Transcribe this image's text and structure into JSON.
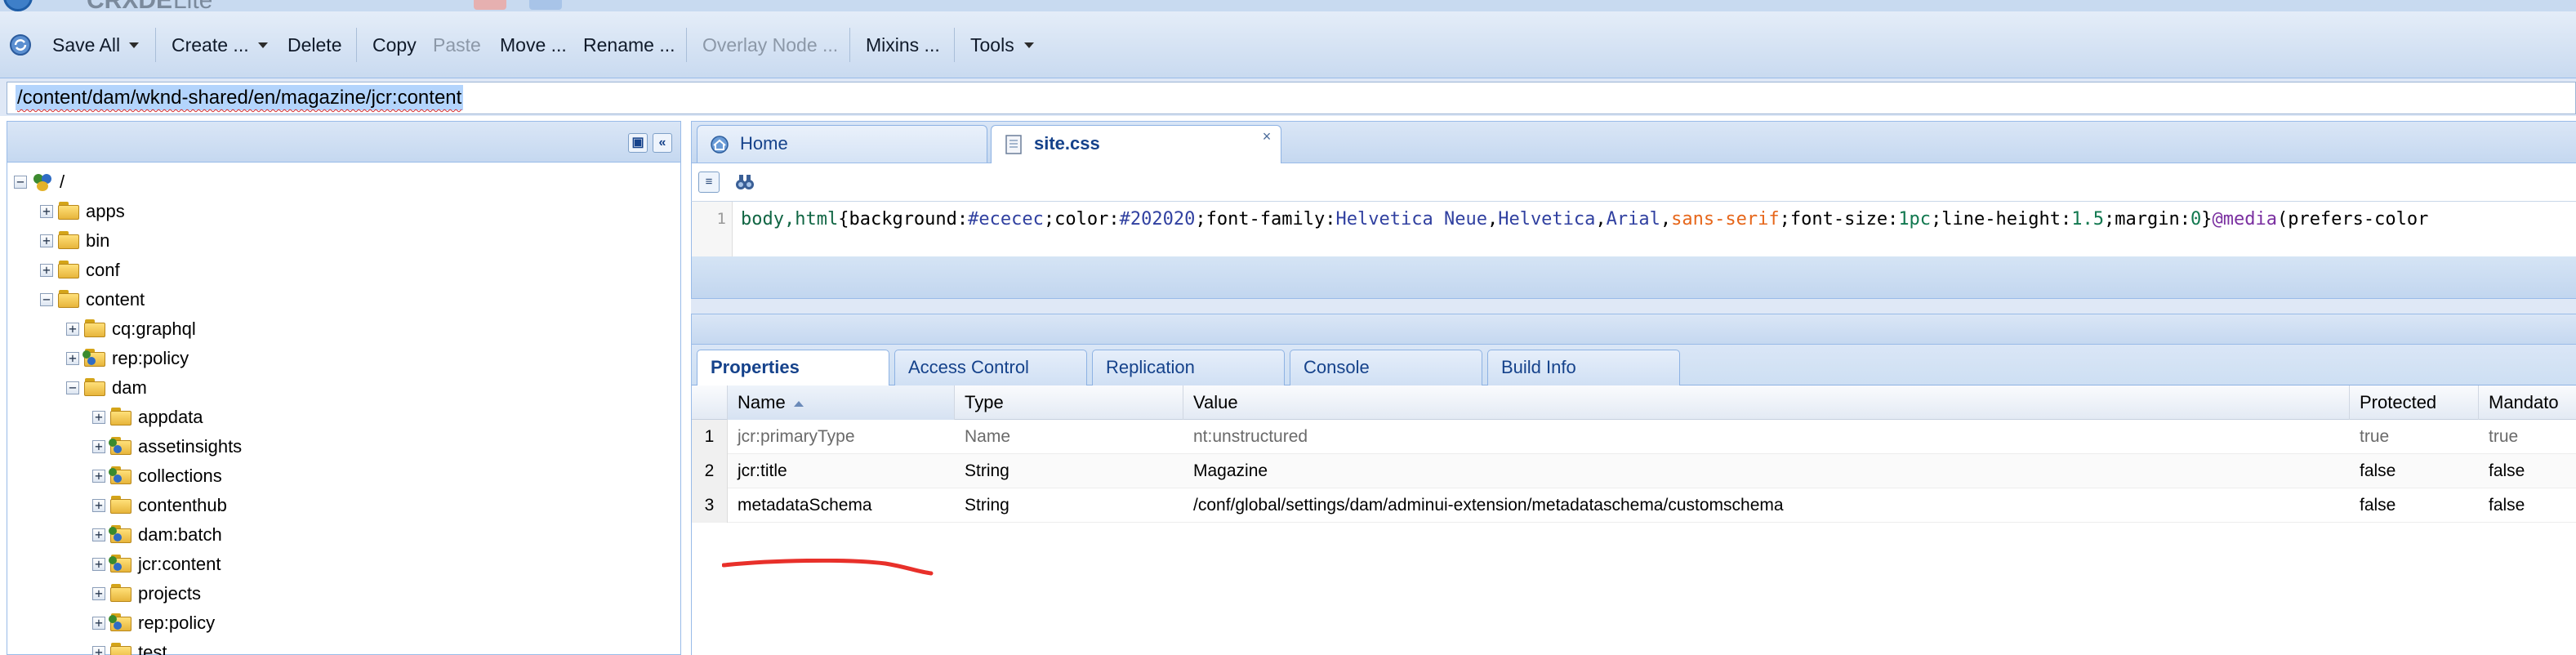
{
  "app": {
    "brand": "CRXDE",
    "edition": "Lite"
  },
  "toolbar": {
    "save_all": "Save All",
    "create": "Create ...",
    "delete": "Delete",
    "copy": "Copy",
    "paste": "Paste",
    "move": "Move ...",
    "rename": "Rename ...",
    "overlay": "Overlay Node ...",
    "mixins": "Mixins ...",
    "tools": "Tools"
  },
  "path": {
    "value": "/content/dam/wknd-shared/en/magazine/jcr:content"
  },
  "tree": {
    "nodes": [
      {
        "label": "/"
      },
      {
        "label": "apps"
      },
      {
        "label": "bin"
      },
      {
        "label": "conf"
      },
      {
        "label": "content"
      },
      {
        "label": "cq:graphql"
      },
      {
        "label": "rep:policy"
      },
      {
        "label": "dam"
      },
      {
        "label": "appdata"
      },
      {
        "label": "assetinsights"
      },
      {
        "label": "collections"
      },
      {
        "label": "contenthub"
      },
      {
        "label": "dam:batch"
      },
      {
        "label": "jcr:content"
      },
      {
        "label": "projects"
      },
      {
        "label": "rep:policy"
      },
      {
        "label": "test"
      }
    ]
  },
  "editor": {
    "tabs": [
      {
        "label": "Home"
      },
      {
        "label": "site.css"
      }
    ],
    "line_number": "1",
    "code": {
      "t1": "body,html",
      "t2": "{background:",
      "t3": "#ececec",
      "t4": ";color:",
      "t5": "#202020",
      "t6": ";font-family:",
      "t7": "Helvetica Neue",
      "t8": ",",
      "t9": "Helvetica",
      "t10": ",",
      "t11": "Arial",
      "t12": ",",
      "t13": "sans-serif",
      "t14": ";font-size:",
      "t15": "1pc",
      "t16": ";line-height:",
      "t17": "1.5",
      "t18": ";margin:",
      "t19": "0",
      "t20": "}",
      "t21": "@media",
      "t22": "(prefers-color"
    }
  },
  "properties": {
    "tabs": [
      "Properties",
      "Access Control",
      "Replication",
      "Console",
      "Build Info"
    ],
    "columns": {
      "name": "Name",
      "type": "Type",
      "value": "Value",
      "protected": "Protected",
      "mandatory": "Mandato"
    },
    "rows": [
      {
        "n": "1",
        "name": "jcr:primaryType",
        "type": "Name",
        "value": "nt:unstructured",
        "protected": "true",
        "mandatory": "true"
      },
      {
        "n": "2",
        "name": "jcr:title",
        "type": "String",
        "value": "Magazine",
        "protected": "false",
        "mandatory": "false"
      },
      {
        "n": "3",
        "name": "metadataSchema",
        "type": "String",
        "value": "/conf/global/settings/dam/adminui-extension/metadataschema/customschema",
        "protected": "false",
        "mandatory": "false"
      }
    ]
  },
  "colors": {
    "accent": "#15428b",
    "panel_border": "#99bbe8",
    "annotation": "#e8302a"
  }
}
